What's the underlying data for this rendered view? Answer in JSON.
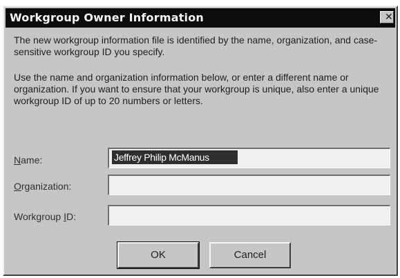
{
  "window": {
    "title": "Workgroup Owner Information",
    "close_glyph": "✕"
  },
  "description": {
    "paragraph1": "The new workgroup information file is identified by the name, organization, and case-sensitive workgroup ID you specify.",
    "paragraph2": "Use the name and organization information below, or enter a different name or organization. If you want to ensure that your workgroup is unique, also enter a unique workgroup ID of up to 20 numbers or letters."
  },
  "fields": {
    "name": {
      "label_hotkey": "N",
      "label_rest": "ame:",
      "value": "Jeffrey Philip McManus"
    },
    "organization": {
      "label_hotkey": "O",
      "label_rest": "rganization:",
      "value": ""
    },
    "workgroup_id": {
      "label_pre": "Workgroup ",
      "label_hotkey": "I",
      "label_post": "D:",
      "value": ""
    }
  },
  "buttons": {
    "ok": "OK",
    "cancel": "Cancel"
  },
  "icons": {
    "close": "close-icon"
  },
  "colors": {
    "titlebar": "#0c0c0c",
    "dialog_face": "#c6c6c6",
    "selection": "#2e2e2e"
  }
}
